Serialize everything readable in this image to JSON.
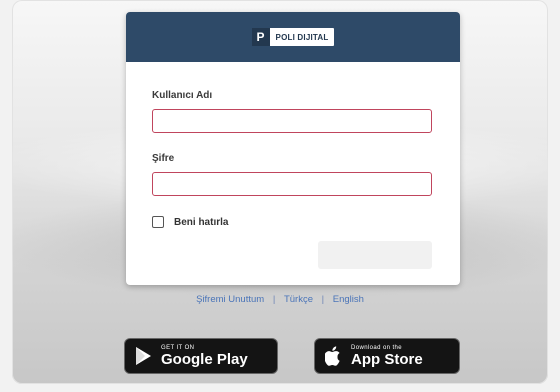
{
  "brand": {
    "mark": "P",
    "name": "POLI DIJITAL"
  },
  "form": {
    "username_label": "Kullanıcı Adı",
    "username_value": "",
    "password_label": "Şifre",
    "password_value": "",
    "remember_label": "Beni hatırla",
    "submit_label": ""
  },
  "links": {
    "forgot": "Şifremi Unuttum",
    "separator": "|",
    "turkish": "Türkçe",
    "english": "English"
  },
  "stores": {
    "google_small": "GET IT ON",
    "google_big": "Google Play",
    "apple_small": "Download on the",
    "apple_big": "App Store"
  },
  "colors": {
    "header": "#2e4a68",
    "input_border": "#c0455d",
    "link": "#4a74b8"
  }
}
